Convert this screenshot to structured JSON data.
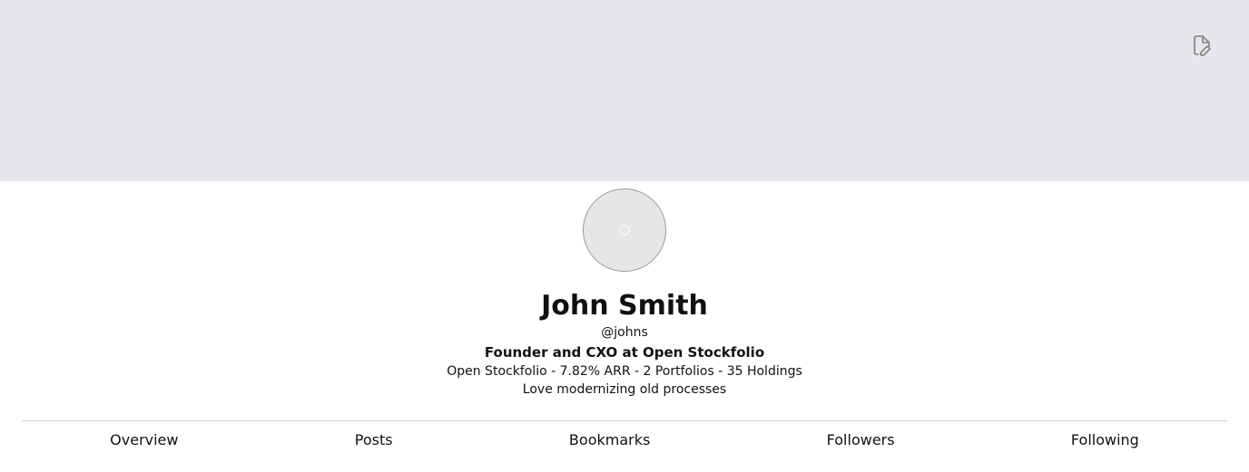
{
  "banner": {
    "edit_icon": "file-edit-icon"
  },
  "profile": {
    "name": "John Smith",
    "handle": "@johns",
    "title": "Founder and CXO at Open Stockfolio",
    "stats": "Open Stockfolio - 7.82% ARR - 2 Portfolios - 35 Holdings",
    "bio": "Love modernizing old processes"
  },
  "tabs": [
    {
      "label": "Overview"
    },
    {
      "label": "Posts"
    },
    {
      "label": "Bookmarks"
    },
    {
      "label": "Followers"
    },
    {
      "label": "Following"
    }
  ]
}
